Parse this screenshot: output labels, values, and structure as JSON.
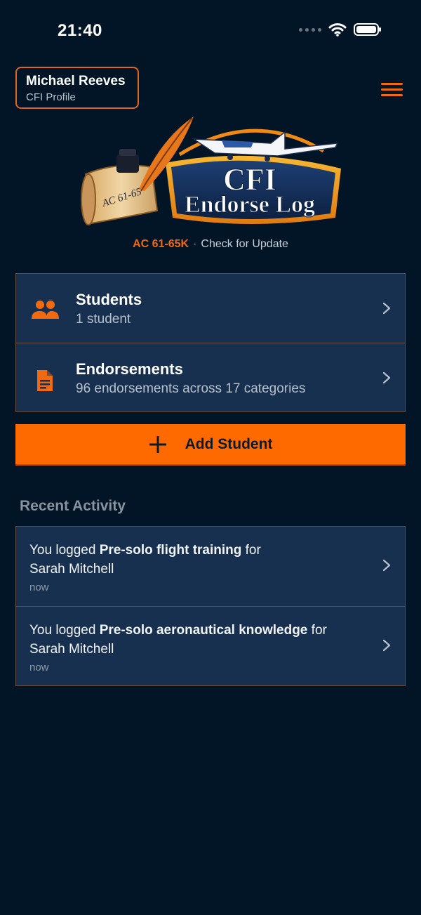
{
  "status_bar": {
    "time": "21:40"
  },
  "profile": {
    "name": "Michael Reeves",
    "role": "CFI Profile"
  },
  "logo": {
    "scroll_text": "AC 61-65",
    "title_line1": "CFI",
    "title_line2": "Endorse Log"
  },
  "version_line": {
    "version": "AC 61-65K",
    "separator": "·",
    "update_link": "Check for Update"
  },
  "nav": [
    {
      "title": "Students",
      "subtitle": "1 student",
      "icon": "people-icon"
    },
    {
      "title": "Endorsements",
      "subtitle": "96 endorsements across 17 categories",
      "icon": "document-icon"
    }
  ],
  "add_button": {
    "label": "Add Student"
  },
  "recent": {
    "title": "Recent Activity",
    "items": [
      {
        "prefix": "You logged ",
        "highlight": "Pre-solo flight training",
        "suffix": " for",
        "student": "Sarah Mitchell",
        "time": "now"
      },
      {
        "prefix": "You logged ",
        "highlight": "Pre-solo aeronautical knowledge",
        "suffix": " for",
        "student": "Sarah Mitchell",
        "time": "now"
      }
    ]
  },
  "colors": {
    "background": "#021526",
    "accent": "#ff6a00",
    "card": "#18304f",
    "border": "#6a4d3d"
  }
}
